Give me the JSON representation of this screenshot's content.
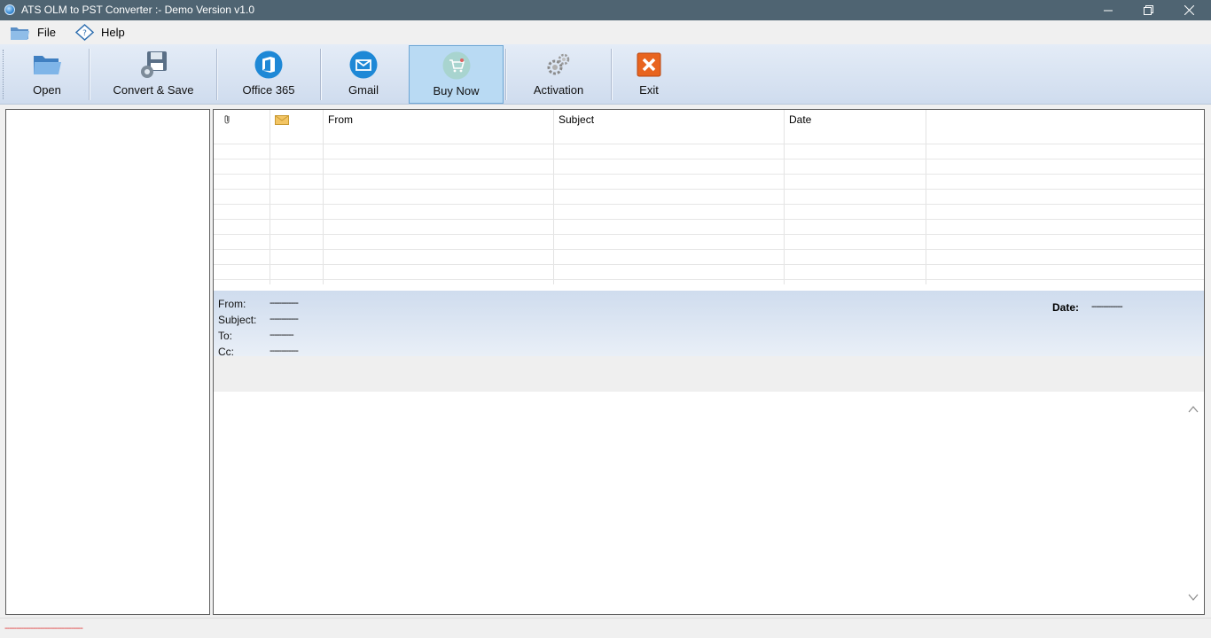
{
  "window": {
    "title": "ATS OLM to PST Converter :- Demo Version v1.0",
    "controls": [
      "minimize-icon",
      "restore-icon",
      "close-icon"
    ]
  },
  "menu": {
    "file": "File",
    "help": "Help"
  },
  "toolbar": {
    "open": "Open",
    "convert_save": "Convert & Save",
    "office365": "Office 365",
    "gmail": "Gmail",
    "buy_now": "Buy Now",
    "activation": "Activation",
    "exit": "Exit"
  },
  "grid": {
    "columns": [
      "",
      "",
      "From",
      "Subject",
      "Date"
    ],
    "column_icons": [
      "paperclip-icon",
      "envelope-icon"
    ]
  },
  "mail_header": {
    "from_label": "From:",
    "from_value": "------------",
    "subject_label": "Subject:",
    "subject_value": "------------",
    "to_label": "To:",
    "to_value": "----------",
    "cc_label": "Cc:",
    "cc_value": "------------",
    "date_label": "Date:",
    "date_value": "-------------"
  },
  "status": {
    "text": "---------------------------------"
  },
  "colors": {
    "titlebar": "#4f6472",
    "toolbar_top": "#e4ecf7",
    "toolbar_bottom": "#cfdcee",
    "active_button": "#b9daf3",
    "status_text": "#e04040"
  }
}
